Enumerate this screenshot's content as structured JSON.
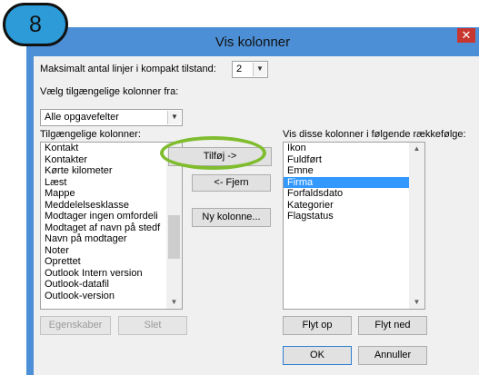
{
  "badge": {
    "number": "8"
  },
  "dialog": {
    "title": "Vis kolonner",
    "close_glyph": "✕"
  },
  "max_lines": {
    "label": "Maksimalt antal linjer i kompakt tilstand:",
    "value": "2"
  },
  "choose_from": {
    "label": "Vælg tilgængelige kolonner fra:",
    "value": "Alle opgavefelter"
  },
  "available": {
    "label": "Tilgængelige kolonner:",
    "items": [
      "Kontakt",
      "Kontakter",
      "Kørte kilometer",
      "Læst",
      "Mappe",
      "Meddelelsesklasse",
      "Modtager ingen omfordeli",
      "Modtaget af navn på stedf",
      "Navn på modtager",
      "Noter",
      "Oprettet",
      "Outlook Intern version",
      "Outlook-datafil",
      "Outlook-version"
    ]
  },
  "shown": {
    "label": "Vis disse kolonner i følgende rækkefølge:",
    "items": [
      "Ikon",
      "Fuldført",
      "Emne",
      "Firma",
      "Forfaldsdato",
      "Kategorier",
      "Flagstatus"
    ],
    "selected": "Firma"
  },
  "buttons": {
    "add": "Tilføj ->",
    "remove": "<- Fjern",
    "new_column": "Ny kolonne...",
    "properties": "Egenskaber",
    "delete": "Slet",
    "move_up": "Flyt op",
    "move_down": "Flyt ned",
    "ok": "OK",
    "cancel": "Annuller"
  },
  "colors": {
    "accent": "#4c8fd6",
    "badge": "#2c9bd8",
    "highlight": "#7fbd2f",
    "selection": "#3399ff",
    "close": "#c7362f"
  }
}
